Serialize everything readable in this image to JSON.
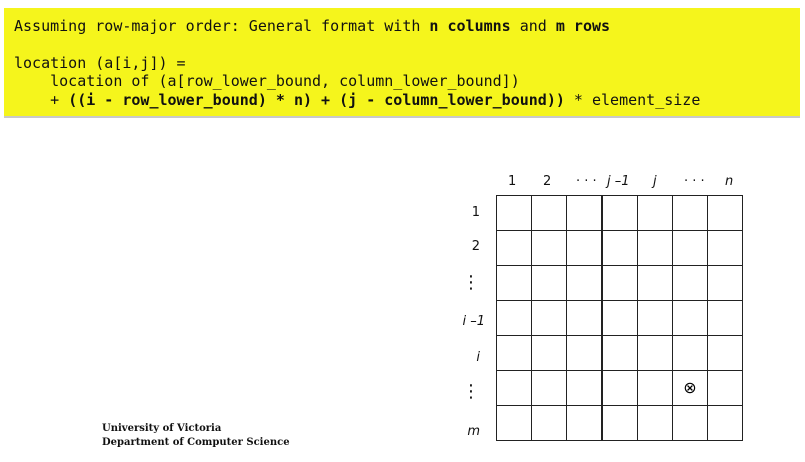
{
  "code": {
    "line1_a": "Assuming row-major order: General format with ",
    "line1_b": "n columns",
    "line1_c": " and ",
    "line1_d": "m rows",
    "line2": "location (a[i,j]) =",
    "line3": "    location of (a[row_lower_bound, column_lower_bound])",
    "line4_a": "    + ",
    "line4_b": "((i - row_lower_bound) * n) + (j - column_lower_bound))",
    "line4_c": " * element_size"
  },
  "grid": {
    "col_labels": [
      "1",
      "2",
      "· · ·",
      "j –1",
      "j",
      "· · ·",
      "n"
    ],
    "row_labels": [
      "1",
      "2",
      "⋮",
      "i –1",
      "i",
      "⋮",
      "m"
    ],
    "marked_cell_symbol": "⊗",
    "marked_row": 5,
    "marked_col": 5
  },
  "footer": {
    "line1": "University of Victoria",
    "line2": "Department of Computer Science"
  }
}
